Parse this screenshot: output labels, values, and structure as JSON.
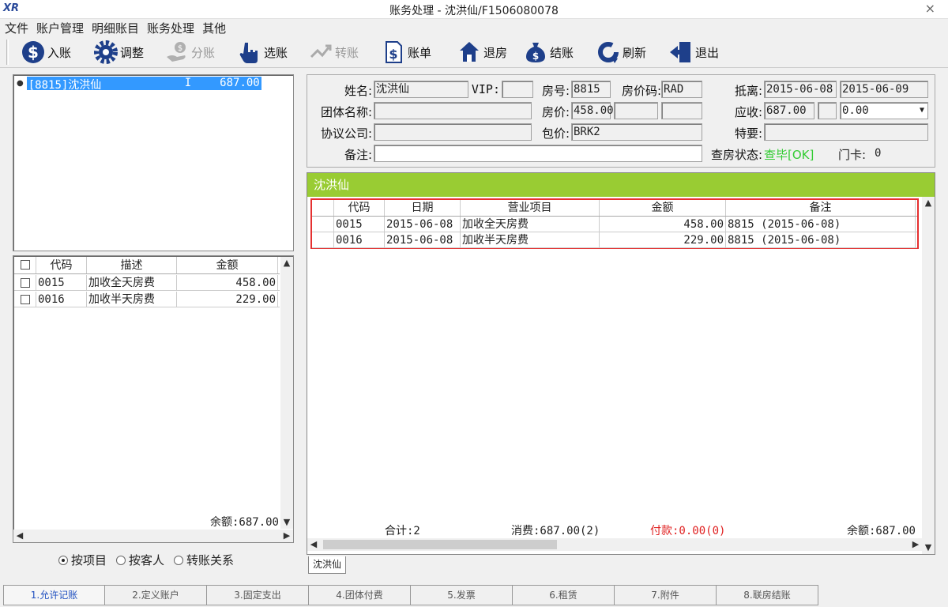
{
  "window": {
    "logo": "XR",
    "title": "账务处理 - 沈洪仙/F1506080078",
    "close": "×"
  },
  "menu": [
    "文件",
    "账户管理",
    "明细账目",
    "账务处理",
    "其他"
  ],
  "toolbar": {
    "post": "入账",
    "adjust": "调整",
    "split": "分账",
    "select": "选账",
    "transfer": "转账",
    "bill": "账单",
    "checkout_room": "退房",
    "settle": "结账",
    "refresh": "刷新",
    "exit": "退出"
  },
  "account_tree": {
    "code": "[8815]沈洪仙",
    "flag": "I",
    "amount": "687.00"
  },
  "item_list": {
    "headers": [
      "代码",
      "描述",
      "金额"
    ],
    "rows": [
      {
        "code": "0015",
        "desc": "加收全天房费",
        "amount": "458.00"
      },
      {
        "code": "0016",
        "desc": "加收半天房费",
        "amount": "229.00"
      }
    ],
    "balance": "余额:687.00"
  },
  "view_mode": {
    "by_item": "按项目",
    "by_guest": "按客人",
    "transfer_rel": "转账关系",
    "selected": "by_item"
  },
  "guest": {
    "name_label": "姓名:",
    "name": "沈洪仙",
    "vip_label": "VIP:",
    "vip": "",
    "room_label": "房号:",
    "room": "8815",
    "rate_code_label": "房价码:",
    "rate_code": "RAD",
    "arrive_label": "抵离:",
    "arrive": "2015-06-08",
    "depart": "2015-06-09",
    "group_label": "团体名称:",
    "group": "",
    "rate_label": "房价:",
    "rate": "458.00",
    "due_label": "应收:",
    "due": "687.00",
    "due_extra": "0.00",
    "company_label": "协议公司:",
    "company": "",
    "package_label": "包价:",
    "package": "BRK2",
    "special_label": "特要:",
    "special": "",
    "remark_label": "备注:",
    "remark": "",
    "inspect_label": "查房状态:",
    "inspect": "查毕[OK]",
    "card_label": "门卡:",
    "card": "0"
  },
  "ledger": {
    "title": "沈洪仙",
    "headers": [
      "代码",
      "日期",
      "营业项目",
      "金额",
      "备注"
    ],
    "rows": [
      {
        "code": "0015",
        "date": "2015-06-08",
        "item": "加收全天房费",
        "amount": "458.00",
        "note": "8815 (2015-06-08)"
      },
      {
        "code": "0016",
        "date": "2015-06-08",
        "item": "加收半天房费",
        "amount": "229.00",
        "note": "8815 (2015-06-08)"
      }
    ],
    "total": "合计:2",
    "consume": "消费:687.00(2)",
    "payment": "付款:0.00(0)",
    "balance": "余额:687.00",
    "tab": "沈洪仙"
  },
  "bottom_tabs": [
    "1.允许记账",
    "2.定义账户",
    "3.固定支出",
    "4.团体付费",
    "5.发票",
    "6.租赁",
    "7.附件",
    "8.联房结账"
  ],
  "colors": {
    "accent_green": "#99cc33",
    "selection_blue": "#3399ff",
    "highlight_red": "#e53030",
    "ok_green": "#33cc33",
    "payment_red": "#e02020"
  }
}
